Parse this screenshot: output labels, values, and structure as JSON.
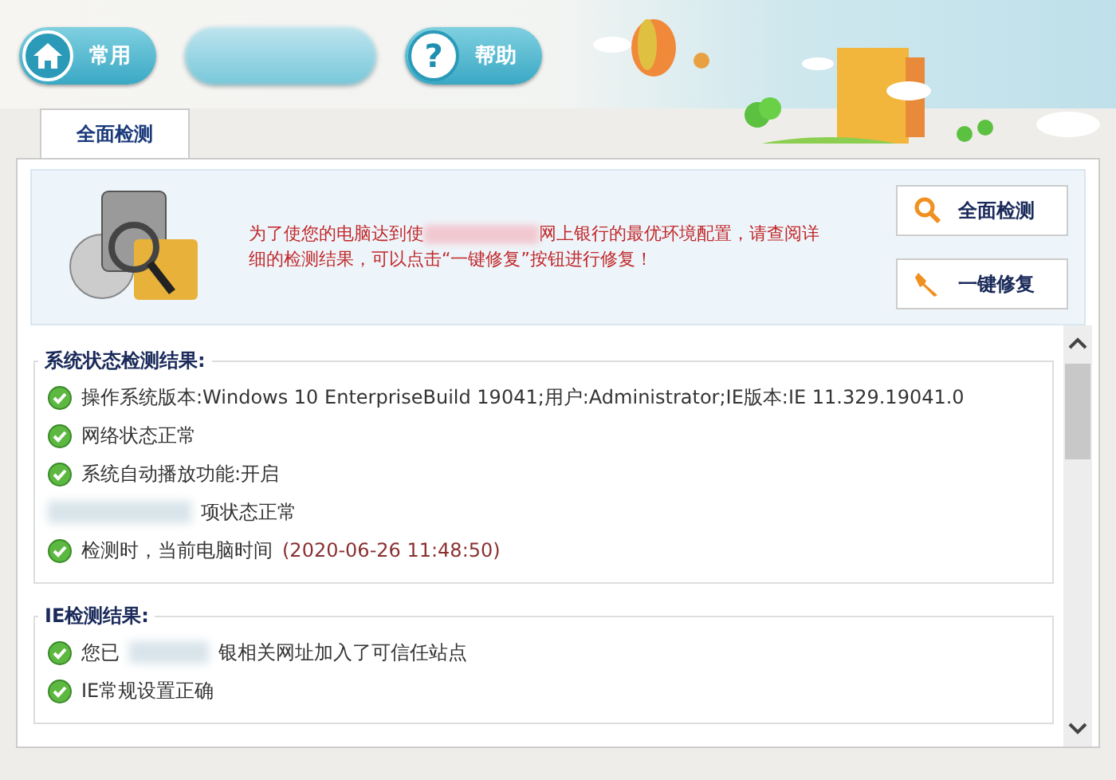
{
  "toolbar": {
    "buttons": [
      {
        "kind": "home",
        "label": "常用"
      },
      {
        "kind": "blurred"
      },
      {
        "kind": "help",
        "label": "帮助",
        "glyph": "?"
      }
    ]
  },
  "tabs": [
    {
      "label": "全面检测",
      "selected": true
    }
  ],
  "intro": {
    "message_start": "为了使您的电脑达到使",
    "message_end": "网上银行的最优环境配置，请查阅详细的检测结果，可以点击“一键修复”按钮进行修复！",
    "actions": [
      {
        "kind": "search",
        "label": "全面检测"
      },
      {
        "kind": "repair",
        "label": "一键修复"
      }
    ]
  },
  "groups": [
    {
      "title": "系统状态检测结果:",
      "items": [
        {
          "text": "操作系统版本:Windows 10 EnterpriseBuild 19041;用户:Administrator;IE版本:IE 11.329.19041.0",
          "obscured": false
        },
        {
          "text": "网络状态正常",
          "obscured": false
        },
        {
          "text": "系统自动播放功能:开启",
          "obscured": false
        },
        {
          "text": "项状态正常",
          "obscured": true
        },
        {
          "text": "检测时，当前电脑时间",
          "time": "(2020-06-26 11:48:50)",
          "obscured": false
        }
      ]
    },
    {
      "title": "IE检测结果:",
      "items": [
        {
          "prefix": "您已",
          "text": "银相关网址加入了可信任站点",
          "obscured": false
        },
        {
          "text": "IE常规设置正确",
          "obscured": false
        }
      ]
    }
  ]
}
